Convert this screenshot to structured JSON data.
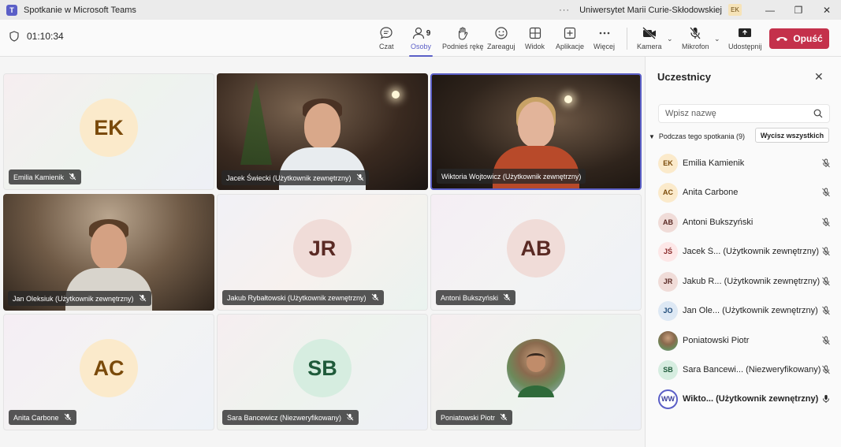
{
  "window": {
    "title": "Spotkanie w Microsoft Teams",
    "more": "···",
    "org": "Uniwersytet Marii Curie-Skłodowskiej",
    "org_badge": "EK",
    "controls": [
      "—",
      "❐",
      "✕"
    ]
  },
  "toolbar": {
    "timer": "01:10:34",
    "chat": "Czat",
    "people": "Osoby",
    "people_count": "9",
    "raise_hand": "Podnieś rękę",
    "react": "Zareaguj",
    "view": "Widok",
    "apps": "Aplikacje",
    "more": "Więcej",
    "camera": "Kamera",
    "mic": "Mikrofon",
    "share": "Udostępnij",
    "leave": "Opuść"
  },
  "tiles": [
    {
      "name": "Emilia Kamienik",
      "initials": "EK"
    },
    {
      "name": "Jacek Świecki (Użytkownik zewnętrzny)"
    },
    {
      "name": "Wiktoria Wojtowicz (Użytkownik zewnętrzny)"
    },
    {
      "name": "Jan Oleksiuk (Użytkownik zewnętrzny)"
    },
    {
      "name": "Jakub Rybałtowski (Użytkownik zewnętrzny)",
      "initials": "JR"
    },
    {
      "name": "Antoni Bukszyński",
      "initials": "AB"
    },
    {
      "name": "Anita Carbone",
      "initials": "AC"
    },
    {
      "name": "Sara Bancewicz (Niezweryfikowany)",
      "initials": "SB"
    },
    {
      "name": "Poniatowski Piotr"
    }
  ],
  "panel": {
    "title": "Uczestnicy",
    "close": "✕",
    "search_placeholder": "Wpisz nazwę",
    "section": "Podczas tego spotkania (9)",
    "mute_all": "Wycisz wszystkich",
    "participants": [
      {
        "initials": "EK",
        "name": "Emilia Kamienik"
      },
      {
        "initials": "AC",
        "name": "Anita Carbone"
      },
      {
        "initials": "AB",
        "name": "Antoni Bukszyński"
      },
      {
        "initials": "JŚ",
        "name": "Jacek Ś...  (Użytkownik zewnętrzny)"
      },
      {
        "initials": "JR",
        "name": "Jakub R... (Użytkownik zewnętrzny)"
      },
      {
        "initials": "JO",
        "name": "Jan Ole...  (Użytkownik zewnętrzny)"
      },
      {
        "initials": "",
        "name": "Poniatowski Piotr"
      },
      {
        "initials": "SB",
        "name": "Sara Bancewi... (Niezweryfikowany)"
      },
      {
        "initials": "WW",
        "name": "Wikto...  (Użytkownik zewnętrzny)"
      }
    ]
  }
}
